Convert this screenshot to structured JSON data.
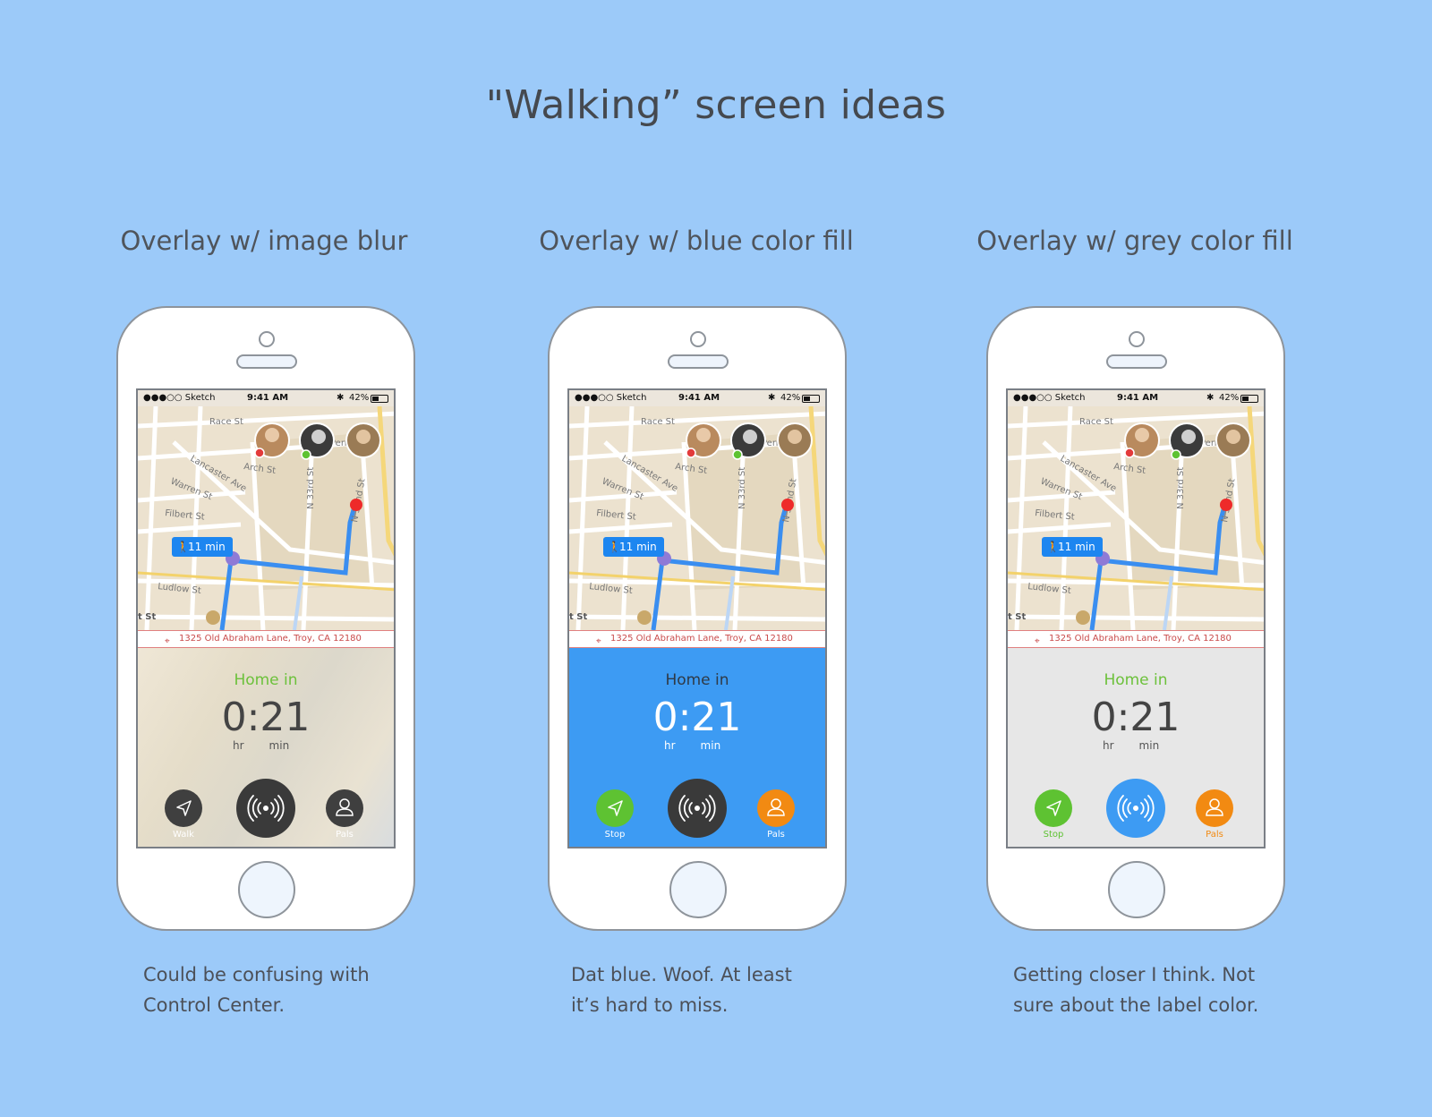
{
  "page_title": "\"Walking” screen ideas",
  "variants": [
    {
      "title": "Overlay w/ image blur",
      "caption_lines": [
        "Could be confusing with",
        "Control Center."
      ],
      "home_in": "Home in",
      "countdown": "0:21",
      "unit_hr": "hr",
      "unit_min": "min",
      "left_button_label": "Walk",
      "right_button_label": "Pals",
      "colors": {
        "overlay": "#e8e1d2",
        "home_in": "#6cc13b",
        "countdown": "#444444",
        "units": "#555555",
        "left_btn": "#3f3f3f",
        "center_btn": "#3a3a3a",
        "right_btn": "#3f3f3f",
        "labels": "#ffffff"
      }
    },
    {
      "title": "Overlay w/ blue color fill",
      "caption_lines": [
        "Dat blue. Woof. At least",
        "it’s hard to miss."
      ],
      "home_in": "Home in",
      "countdown": "0:21",
      "unit_hr": "hr",
      "unit_min": "min",
      "left_button_label": "Stop",
      "right_button_label": "Pals",
      "colors": {
        "overlay": "#3d9bf3",
        "home_in": "#2f3a46",
        "countdown": "#ffffff",
        "units": "#ffffff",
        "left_btn": "#5ec232",
        "center_btn": "#3a3a3a",
        "right_btn": "#f28a12",
        "labels": "#ffffff"
      }
    },
    {
      "title": "Overlay w/ grey color fill",
      "caption_lines": [
        "Getting closer I think. Not",
        "sure about the label color."
      ],
      "home_in": "Home in",
      "countdown": "0:21",
      "unit_hr": "hr",
      "unit_min": "min",
      "left_button_label": "Stop",
      "right_button_label": "Pals",
      "colors": {
        "overlay": "#e7e7e7",
        "home_in": "#6cc13b",
        "countdown": "#444444",
        "units": "#555555",
        "left_btn": "#5ec232",
        "center_btn": "#3d9bf3",
        "right_btn": "#f28a12",
        "labels_left": "#5ec232",
        "labels_right": "#f28a12"
      }
    }
  ],
  "status_bar": {
    "carrier": "●●●○○ Sketch",
    "time": "9:41 AM",
    "bluetooth": "✱",
    "battery": "42%"
  },
  "map": {
    "streets": [
      "Race St",
      "Lancaster Ave",
      "Arch St",
      "Warren St",
      "Filbert St",
      "Ludlow St",
      "N 33rd St",
      "N 32nd St",
      "t St",
      "Perry"
    ],
    "walk_chip": "11 min",
    "address": "1325 Old Abraham Lane, Troy, CA 12180"
  },
  "icons": {
    "left": "navigation-arrow-icon",
    "center": "broadcast-signal-icon",
    "right": "person-icon",
    "pin": "location-pin-icon",
    "walk": "walking-person-icon"
  }
}
